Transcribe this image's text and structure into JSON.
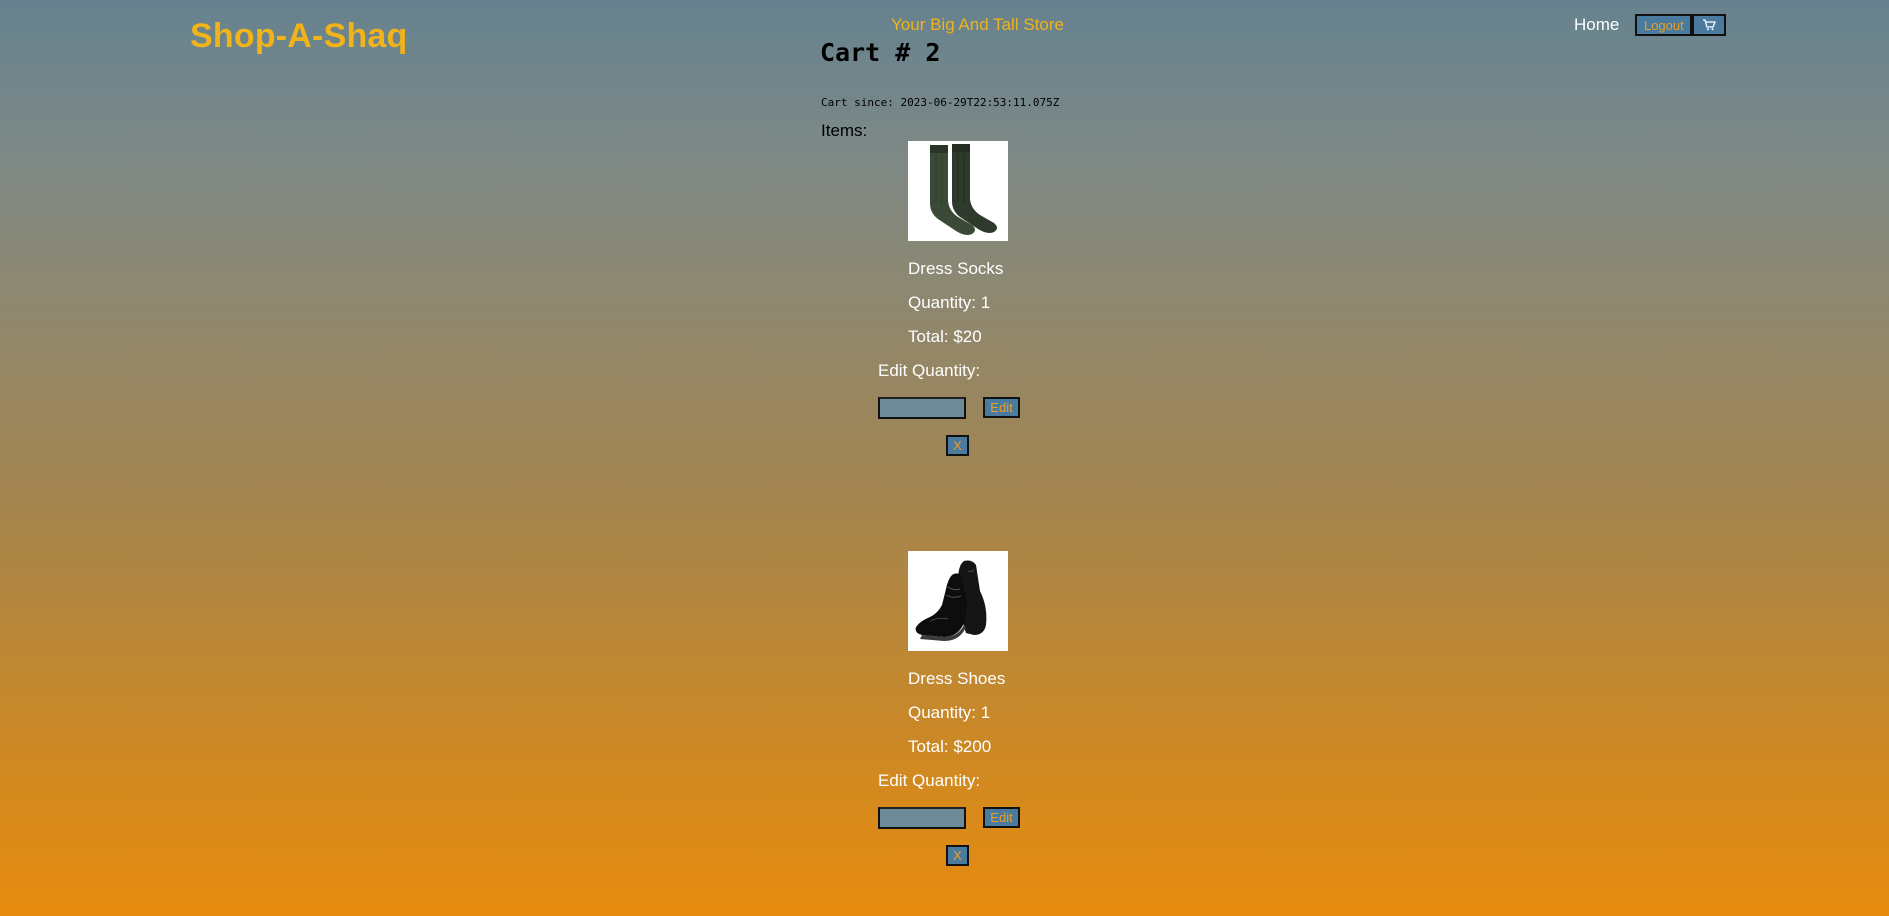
{
  "header": {
    "brand": "Shop-A-Shaq",
    "tagline": "Your Big And Tall Store",
    "nav": {
      "home_label": "Home",
      "logout_label": "Logout",
      "cart_icon": "shopping-cart-icon"
    }
  },
  "cart": {
    "title": "Cart # 2",
    "since": "Cart since: 2023-06-29T22:53:11.075Z",
    "items_label": "Items:",
    "items": [
      {
        "image": "dress-socks-image",
        "name": "Dress Socks",
        "quantity": "Quantity: 1",
        "total": "Total: $20",
        "edit_label": "Edit Quantity:",
        "quantity_value": "",
        "edit_button": "Edit",
        "remove_button": "X"
      },
      {
        "image": "dress-shoes-image",
        "name": "Dress Shoes",
        "quantity": "Quantity: 1",
        "total": "Total: $200",
        "edit_label": "Edit Quantity:",
        "quantity_value": "",
        "edit_button": "Edit",
        "remove_button": "X"
      }
    ]
  },
  "colors": {
    "brand": "#f0b319",
    "button_bg": "#4a7a9e",
    "button_text": "#e8a02a",
    "gradient_top": "#66828f",
    "gradient_bottom": "#e78b0f"
  }
}
